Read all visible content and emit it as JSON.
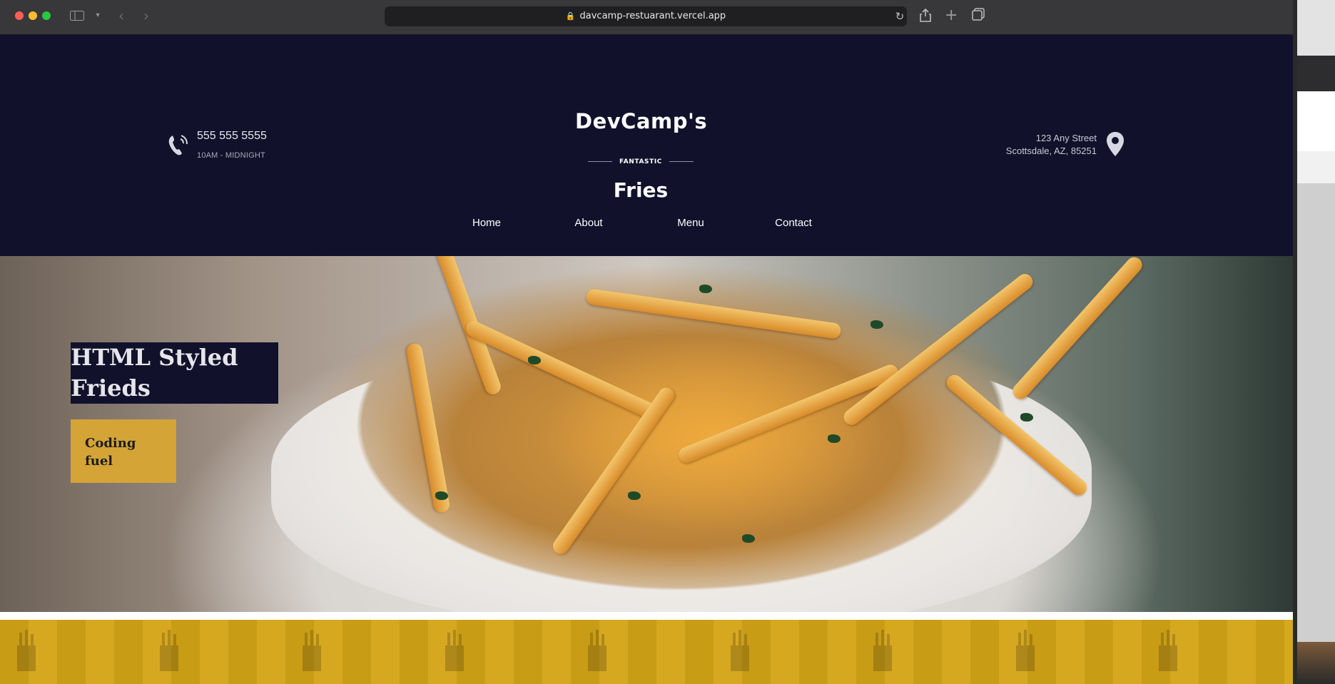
{
  "browser": {
    "url": "davcamp-restuarant.vercel.app",
    "icons": [
      "sidebar-icon",
      "chevron-down-icon",
      "back-icon",
      "forward-icon",
      "lock-icon",
      "reload-icon",
      "share-icon",
      "new-tab-icon",
      "tab-overview-icon"
    ]
  },
  "header": {
    "phone": "555 555 5555",
    "hours": "10AM - MIDNIGHT",
    "logo": {
      "top": "DevCamp's",
      "middle": "FANTASTIC",
      "bottom": "Fries"
    },
    "address": {
      "line1": "123 Any Street",
      "line2": "Scottsdale, AZ, 85251"
    },
    "icons": [
      "phone-icon",
      "map-pin-icon"
    ]
  },
  "nav": {
    "items": [
      {
        "label": "Home"
      },
      {
        "label": "About"
      },
      {
        "label": "Menu"
      },
      {
        "label": "Contact"
      }
    ]
  },
  "hero": {
    "title": "HTML Styled Frieds",
    "button_label": "Coding fuel"
  },
  "colors": {
    "header_bg": "#11112b",
    "accent_gold": "#d4a437",
    "pattern_gold": "#d4a417"
  }
}
